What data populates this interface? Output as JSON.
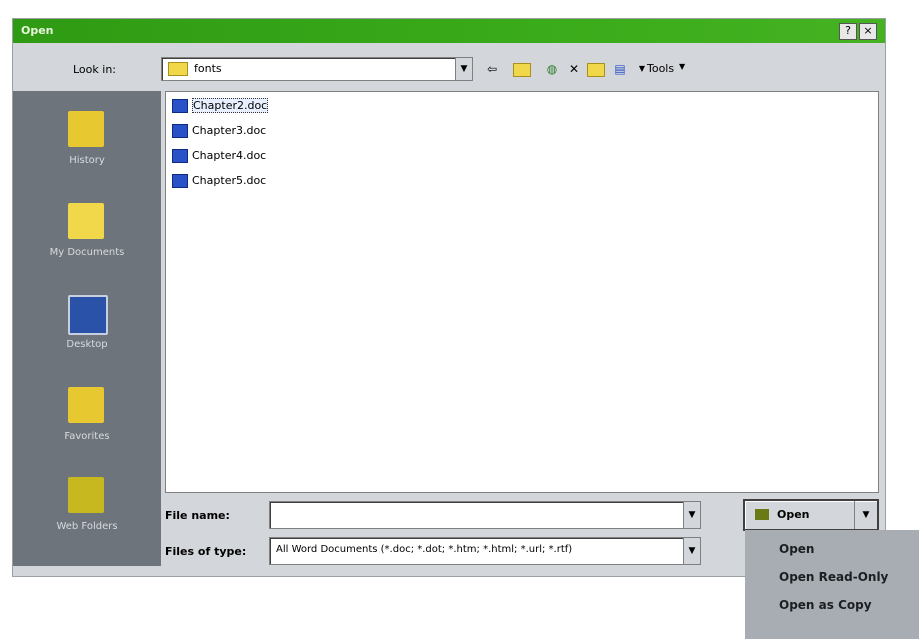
{
  "window": {
    "title": "Open",
    "help_glyph": "?",
    "close_glyph": "×"
  },
  "lookin": {
    "label": "Look in:",
    "value": "fonts"
  },
  "toolbar": {
    "tools_label": "Tools"
  },
  "places": [
    {
      "label": "History",
      "icon": "history-folder-icon"
    },
    {
      "label": "My Documents",
      "icon": "documents-folder-icon"
    },
    {
      "label": "Desktop",
      "icon": "desktop-icon"
    },
    {
      "label": "Favorites",
      "icon": "favorites-folder-icon"
    },
    {
      "label": "Web Folders",
      "icon": "web-folders-icon"
    }
  ],
  "files": [
    {
      "name": "Chapter2.doc",
      "selected": true
    },
    {
      "name": "Chapter3.doc",
      "selected": false
    },
    {
      "name": "Chapter4.doc",
      "selected": false
    },
    {
      "name": "Chapter5.doc",
      "selected": false
    }
  ],
  "filename": {
    "label": "File name:",
    "value": ""
  },
  "filetype": {
    "label": "Files of type:",
    "value": "All Word Documents (*.doc; *.dot; *.htm; *.html; *.url; *.rtf)"
  },
  "open_button": {
    "label": "Open"
  },
  "open_menu": [
    {
      "label": "Open"
    },
    {
      "label": "Open Read-Only"
    },
    {
      "label": "Open as Copy"
    }
  ]
}
